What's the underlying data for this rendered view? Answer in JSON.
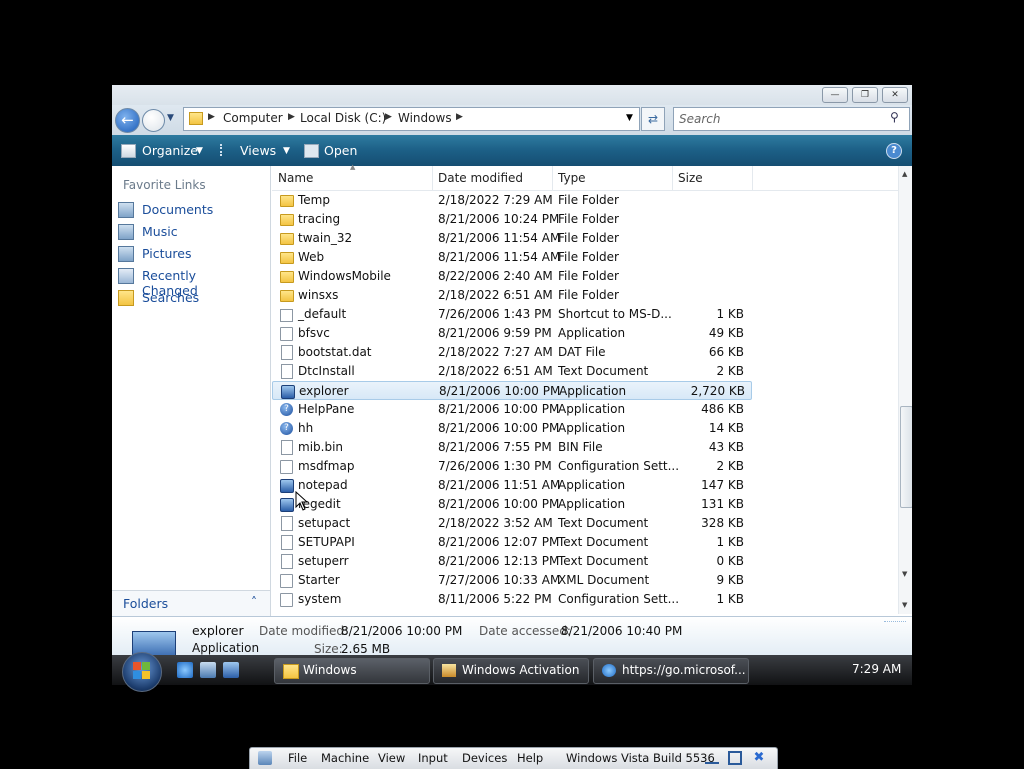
{
  "window": {
    "address": {
      "crumbs": [
        "Computer",
        "Local Disk (C:)",
        "Windows"
      ]
    },
    "search_placeholder": "Search",
    "toolbar": {
      "organize": "Organize",
      "views": "Views",
      "open": "Open"
    },
    "nav_pane": {
      "header": "Favorite Links",
      "items": [
        {
          "label": "Documents",
          "icon": "documents-icon"
        },
        {
          "label": "Music",
          "icon": "music-icon"
        },
        {
          "label": "Pictures",
          "icon": "pictures-icon"
        },
        {
          "label": "Recently Changed",
          "icon": "recently-changed-icon"
        },
        {
          "label": "Searches",
          "icon": "searches-icon"
        }
      ],
      "folders_label": "Folders"
    },
    "columns": {
      "name": "Name",
      "date": "Date modified",
      "type": "Type",
      "size": "Size"
    },
    "files": [
      {
        "name": "Temp",
        "date": "2/18/2022 7:29 AM",
        "type": "File Folder",
        "size": "",
        "icon": "folder"
      },
      {
        "name": "tracing",
        "date": "8/21/2006 10:24 PM",
        "type": "File Folder",
        "size": "",
        "icon": "folder"
      },
      {
        "name": "twain_32",
        "date": "8/21/2006 11:54 AM",
        "type": "File Folder",
        "size": "",
        "icon": "folder"
      },
      {
        "name": "Web",
        "date": "8/21/2006 11:54 AM",
        "type": "File Folder",
        "size": "",
        "icon": "folder"
      },
      {
        "name": "WindowsMobile",
        "date": "8/22/2006 2:40 AM",
        "type": "File Folder",
        "size": "",
        "icon": "folder"
      },
      {
        "name": "winsxs",
        "date": "2/18/2022 6:51 AM",
        "type": "File Folder",
        "size": "",
        "icon": "folder"
      },
      {
        "name": "_default",
        "date": "7/26/2006 1:43 PM",
        "type": "Shortcut to MS-D...",
        "size": "1 KB",
        "icon": "shortcut"
      },
      {
        "name": "bfsvc",
        "date": "8/21/2006 9:59 PM",
        "type": "Application",
        "size": "49 KB",
        "icon": "cfg"
      },
      {
        "name": "bootstat.dat",
        "date": "2/18/2022 7:27 AM",
        "type": "DAT File",
        "size": "66 KB",
        "icon": "file"
      },
      {
        "name": "DtcInstall",
        "date": "2/18/2022 6:51 AM",
        "type": "Text Document",
        "size": "2 KB",
        "icon": "file"
      },
      {
        "name": "explorer",
        "date": "8/21/2006 10:00 PM",
        "type": "Application",
        "size": "2,720 KB",
        "icon": "app",
        "selected": true
      },
      {
        "name": "HelpPane",
        "date": "8/21/2006 10:00 PM",
        "type": "Application",
        "size": "486 KB",
        "icon": "help"
      },
      {
        "name": "hh",
        "date": "8/21/2006 10:00 PM",
        "type": "Application",
        "size": "14 KB",
        "icon": "help"
      },
      {
        "name": "mib.bin",
        "date": "8/21/2006 7:55 PM",
        "type": "BIN File",
        "size": "43 KB",
        "icon": "bin"
      },
      {
        "name": "msdfmap",
        "date": "7/26/2006 1:30 PM",
        "type": "Configuration Sett...",
        "size": "2 KB",
        "icon": "cfg"
      },
      {
        "name": "notepad",
        "date": "8/21/2006 11:51 AM",
        "type": "Application",
        "size": "147 KB",
        "icon": "app"
      },
      {
        "name": "regedit",
        "date": "8/21/2006 10:00 PM",
        "type": "Application",
        "size": "131 KB",
        "icon": "app"
      },
      {
        "name": "setupact",
        "date": "2/18/2022 3:52 AM",
        "type": "Text Document",
        "size": "328 KB",
        "icon": "file"
      },
      {
        "name": "SETUPAPI",
        "date": "8/21/2006 12:07 PM",
        "type": "Text Document",
        "size": "1 KB",
        "icon": "file"
      },
      {
        "name": "setuperr",
        "date": "8/21/2006 12:13 PM",
        "type": "Text Document",
        "size": "0 KB",
        "icon": "file"
      },
      {
        "name": "Starter",
        "date": "7/27/2006 10:33 AM",
        "type": "XML Document",
        "size": "9 KB",
        "icon": "cfg"
      },
      {
        "name": "system",
        "date": "8/11/2006 5:22 PM",
        "type": "Configuration Sett...",
        "size": "1 KB",
        "icon": "cfg"
      }
    ],
    "details": {
      "name": "explorer",
      "type": "Application",
      "date_modified_label": "Date modified:",
      "date_modified": "8/21/2006 10:00 PM",
      "date_accessed_label": "Date accessed:",
      "date_accessed": "8/21/2006 10:40 PM",
      "size_label": "Size:",
      "size": "2.65 MB"
    }
  },
  "taskbar": {
    "buttons": [
      {
        "label": "Windows",
        "icon": "folder-icon"
      },
      {
        "label": "Windows Activation",
        "icon": "activation-icon"
      },
      {
        "label": "https://go.microsof...",
        "icon": "ie-icon"
      }
    ],
    "clock": "7:29 AM"
  },
  "vbox_menu": {
    "items": [
      "File",
      "Machine",
      "View",
      "Input",
      "Devices",
      "Help"
    ],
    "title": "Windows Vista Build 5536"
  },
  "colors": {
    "toolbar": "#1c5f86",
    "link": "#1a4d9a",
    "selection": "#d7e8f7"
  }
}
